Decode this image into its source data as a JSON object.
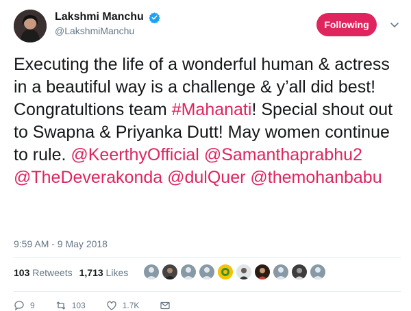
{
  "profile": {
    "display_name": "Lakshmi Manchu",
    "handle": "@LakshmiManchu",
    "verified": true
  },
  "follow_button": {
    "label": "Following",
    "color": "#e0245e"
  },
  "tweet": {
    "text_parts": [
      "Executing the life of a wonderful human & actress in a beautiful way is a challenge & y’all did best! Congratultions team ",
      "#Mahanati",
      "! Special shout out to Swapna & Priyanka Dutt! May women continue to rule. ",
      "@KeerthyOfficial",
      " ",
      "@Samanthaprabhu2",
      " ",
      "@TheDeverakonda",
      " ",
      "@dulQuer",
      " ",
      "@themohanbabu"
    ],
    "link_color": "#e0245e"
  },
  "timestamp": "9:59 AM - 9 May 2018",
  "stats": {
    "retweets_count": "103",
    "retweets_label": "Retweets",
    "likes_count": "1,713",
    "likes_label": "Likes"
  },
  "actions": {
    "replies": "9",
    "retweets": "103",
    "likes": "1.7K"
  }
}
